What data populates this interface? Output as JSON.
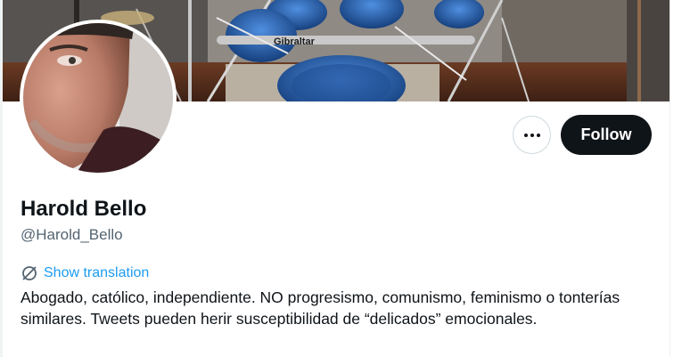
{
  "profile": {
    "display_name": "Harold Bello",
    "handle": "@Harold_Bello",
    "bio": "Abogado, católico, independiente. NO progresismo, comunismo, feminismo o tonterías similares. Tweets pueden herir susceptibilidad de “delicados” emocionales."
  },
  "banner": {
    "kit_brand": "Gibraltar"
  },
  "actions": {
    "more_icon": "more-horizontal-icon",
    "follow_label": "Follow"
  },
  "translation": {
    "icon": "translate-icon",
    "label": "Show translation"
  },
  "colors": {
    "primary_text": "#0f1419",
    "secondary_text": "#536471",
    "link": "#1d9bf0",
    "follow_bg": "#0f1419",
    "border": "#cfd9de"
  }
}
